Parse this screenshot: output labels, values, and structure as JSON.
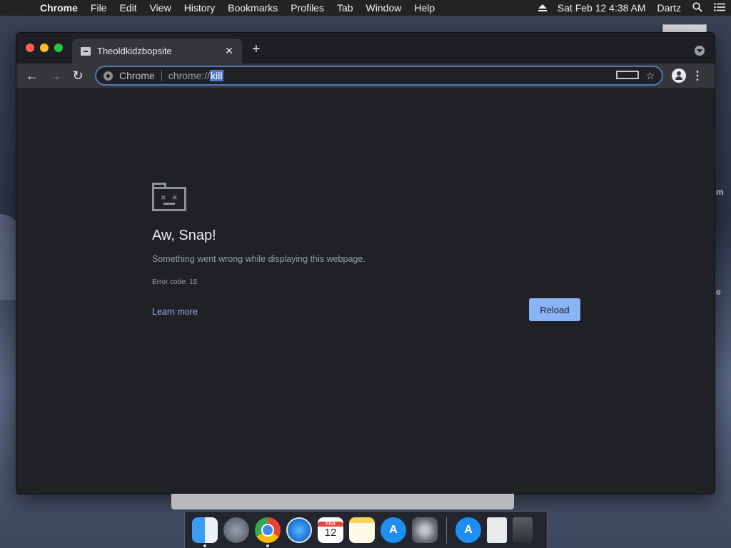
{
  "menubar": {
    "app_name": "Chrome",
    "items": [
      "File",
      "Edit",
      "View",
      "History",
      "Bookmarks",
      "Profiles",
      "Tab",
      "Window",
      "Help"
    ],
    "clock": "Sat Feb 12  4:38 AM",
    "user": "Dartz"
  },
  "desktop": {
    "fragment_1": "m",
    "fragment_2": "e"
  },
  "browser": {
    "tab": {
      "title": "Theoldkidzbopsite",
      "close_glyph": "✕"
    },
    "new_tab_glyph": "+",
    "toolbar": {
      "back_glyph": "←",
      "forward_glyph": "→",
      "reload_glyph": "↻",
      "omnibox": {
        "chip": "Chrome",
        "url_prefix": "chrome://",
        "url_selected": "kill"
      },
      "bookmark_glyph": "☆",
      "menu_glyph": "⋮"
    }
  },
  "error_page": {
    "title": "Aw, Snap!",
    "message": "Something went wrong while displaying this webpage.",
    "error_code": "Error code: 15",
    "learn_more": "Learn more",
    "reload": "Reload"
  },
  "dock": {
    "calendar_month": "FEB",
    "calendar_day": "12",
    "items": [
      "finder",
      "launchpad",
      "chrome",
      "safari",
      "calendar",
      "notes",
      "app-store",
      "system-preferences",
      "app-store-downloads",
      "file",
      "trash"
    ]
  }
}
